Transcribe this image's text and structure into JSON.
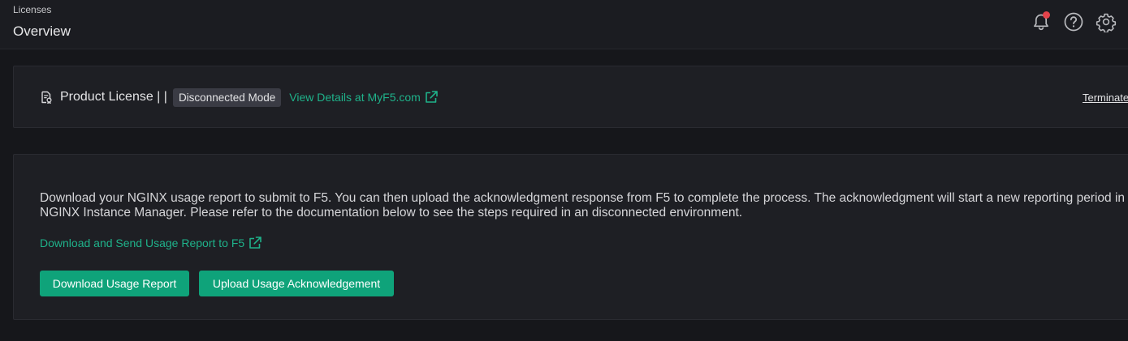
{
  "header": {
    "breadcrumb": "Licenses",
    "title": "Overview",
    "icons": [
      "bell-icon",
      "help-icon",
      "gear-icon"
    ],
    "notification_dot_color": "#e4434b"
  },
  "license_card": {
    "title": "Product License | |",
    "mode_badge": "Disconnected Mode",
    "details_link": "View Details at MyF5.com",
    "terminate_link": "Terminate"
  },
  "usage_card": {
    "description": "Download your NGINX usage report to submit to F5. You can then upload the acknowledgment response from F5 to complete the process. The acknowledgment will start a new reporting period in NGINX Instance Manager. Please refer to the documentation below to see the steps required in an disconnected environment.",
    "doc_link": "Download and Send Usage Report to F5",
    "download_button": "Download Usage Report",
    "upload_button": "Upload Usage Acknowledgement"
  },
  "colors": {
    "accent": "#0fa37a",
    "link": "#1fb28a",
    "background": "#16171b",
    "card": "#1e1f24"
  }
}
